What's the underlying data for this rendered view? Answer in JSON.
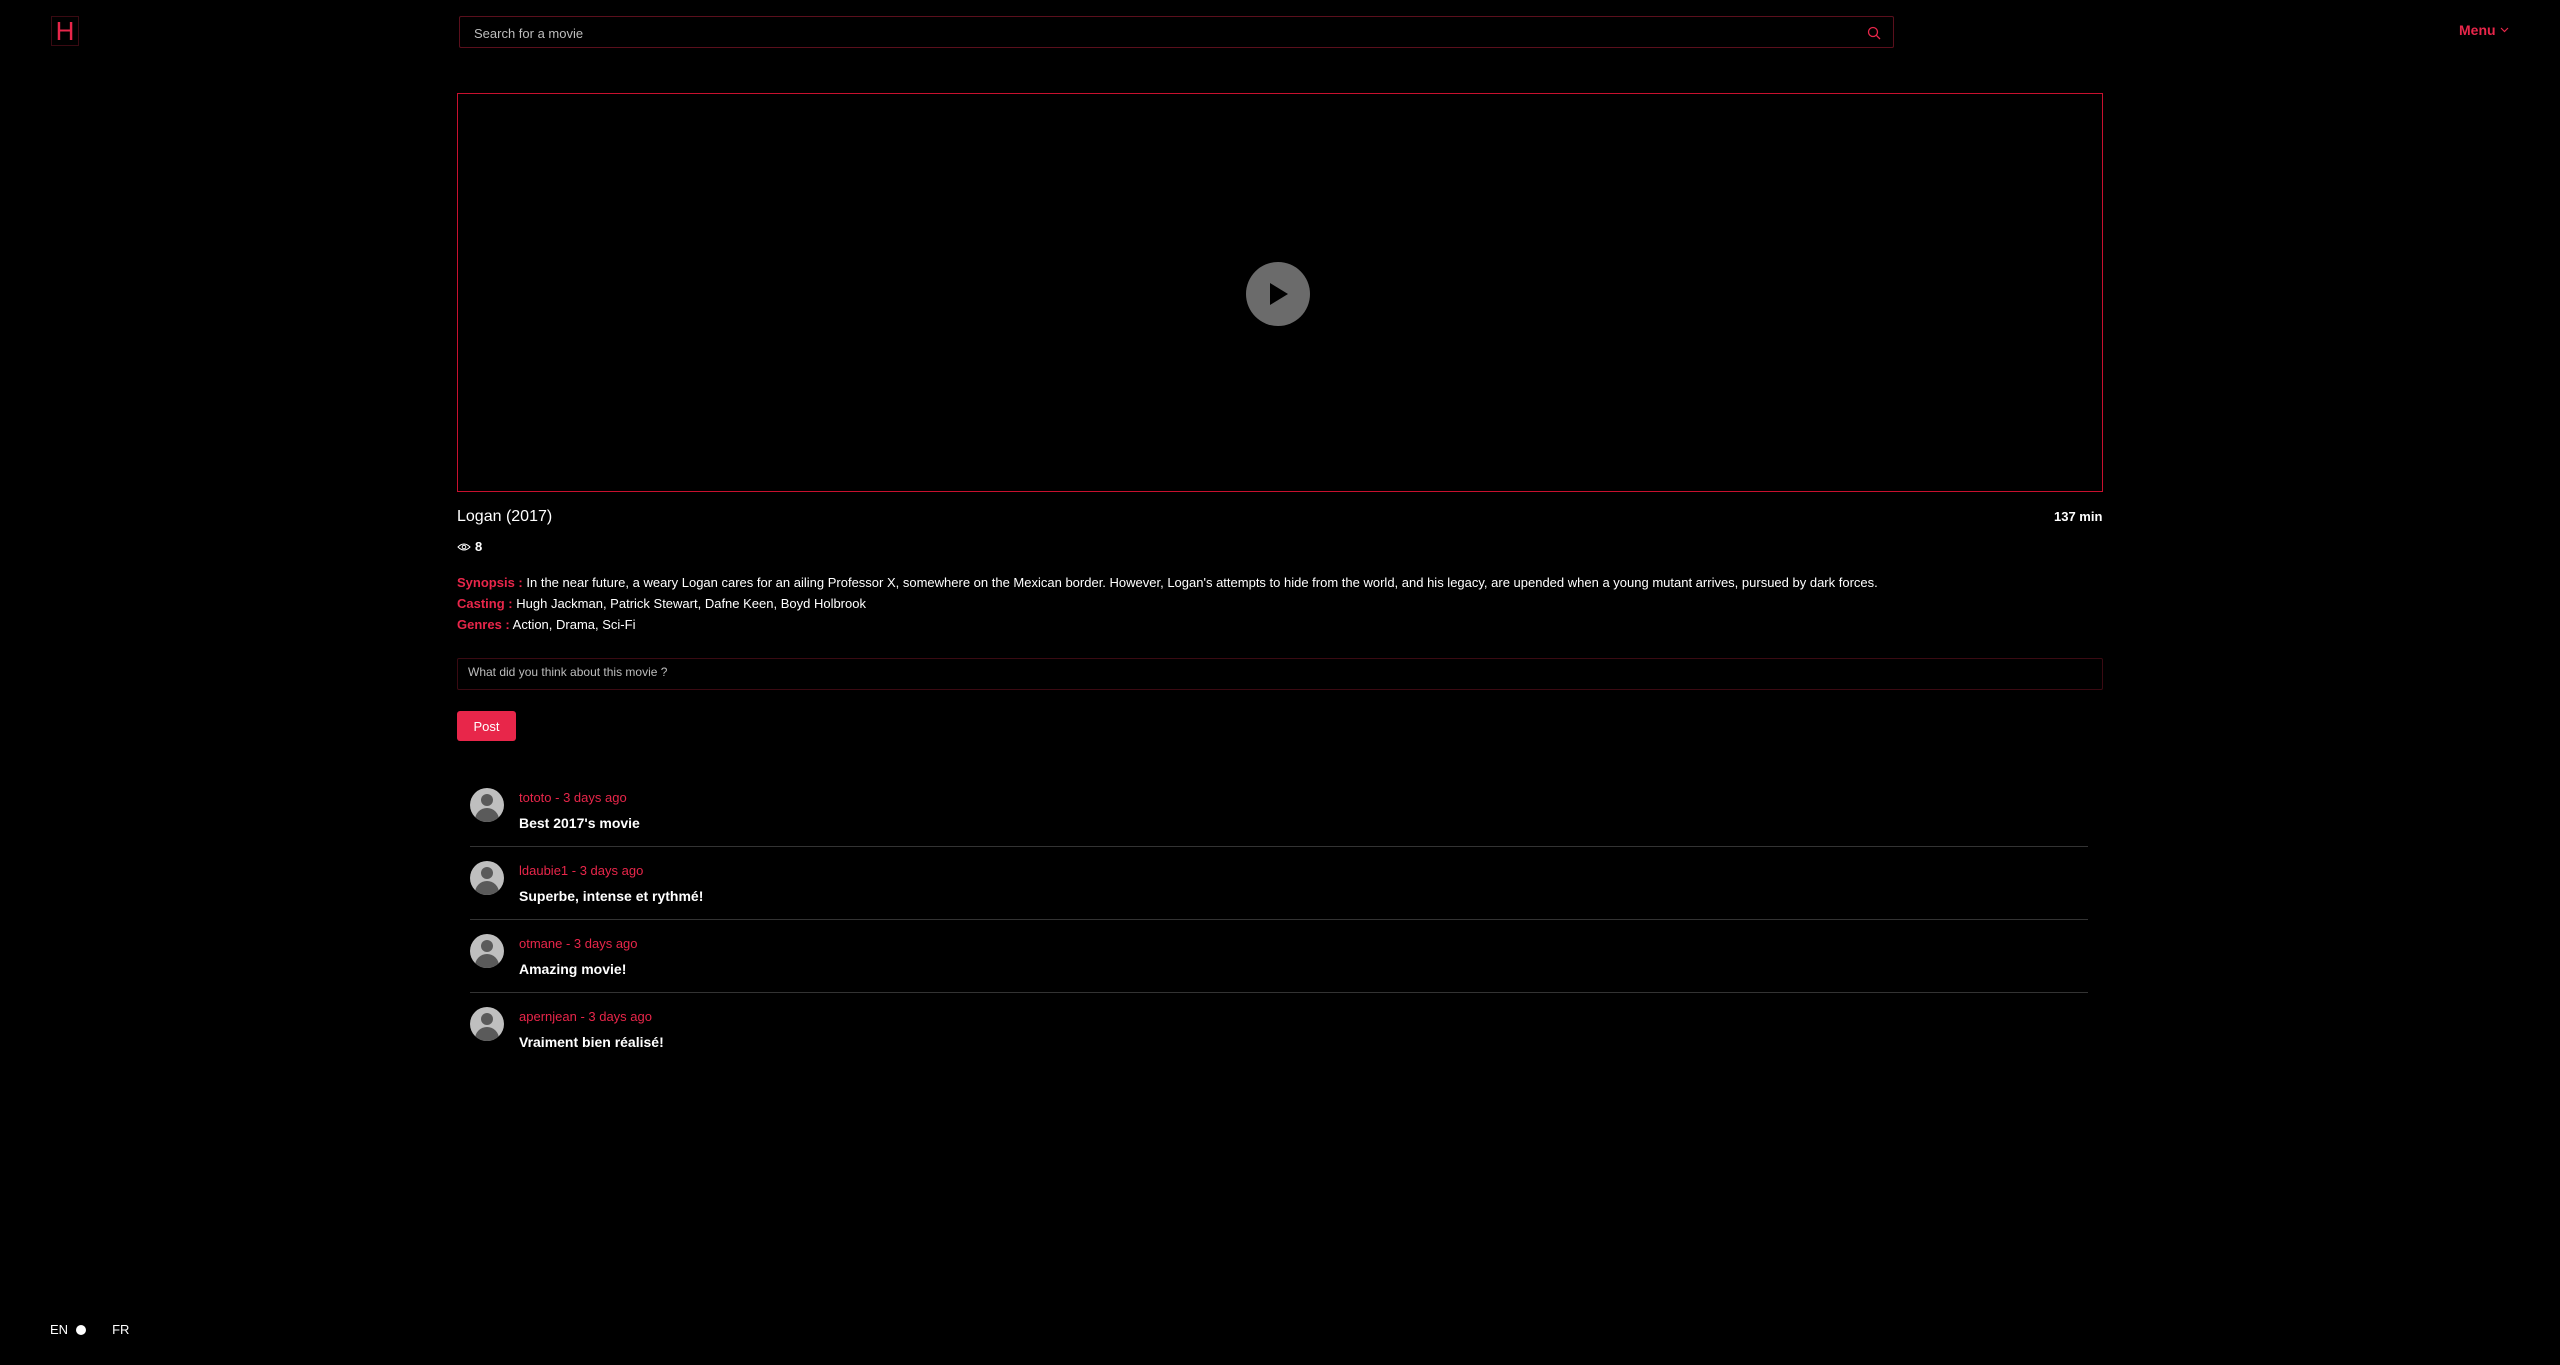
{
  "logo": "H",
  "search": {
    "placeholder": "Search for a movie"
  },
  "menu": {
    "label": "Menu"
  },
  "movie": {
    "title": "Logan (2017)",
    "duration": "137 min",
    "views": "8",
    "synopsis_label": "Synopsis :",
    "synopsis": "In the near future, a weary Logan cares for an ailing Professor X, somewhere on the Mexican border. However, Logan's attempts to hide from the world, and his legacy, are upended when a young mutant arrives, pursued by dark forces.",
    "casting_label": "Casting :",
    "casting": "Hugh Jackman, Patrick Stewart, Dafne Keen, Boyd Holbrook",
    "genres_label": "Genres :",
    "genres": "Action, Drama, Sci-Fi"
  },
  "comment_form": {
    "placeholder": "What did you think about this movie ?",
    "post_label": "Post"
  },
  "comments": [
    {
      "meta": "tototo - 3 days ago",
      "text": "Best 2017's movie"
    },
    {
      "meta": "ldaubie1 - 3 days ago",
      "text": "Superbe, intense et rythmé!"
    },
    {
      "meta": "otmane - 3 days ago",
      "text": "Amazing movie!"
    },
    {
      "meta": "apernjean - 3 days ago",
      "text": "Vraiment bien réalisé!"
    }
  ],
  "language": {
    "en": "EN",
    "fr": "FR"
  },
  "colors": {
    "accent": "#e8264a",
    "background": "#000000"
  }
}
